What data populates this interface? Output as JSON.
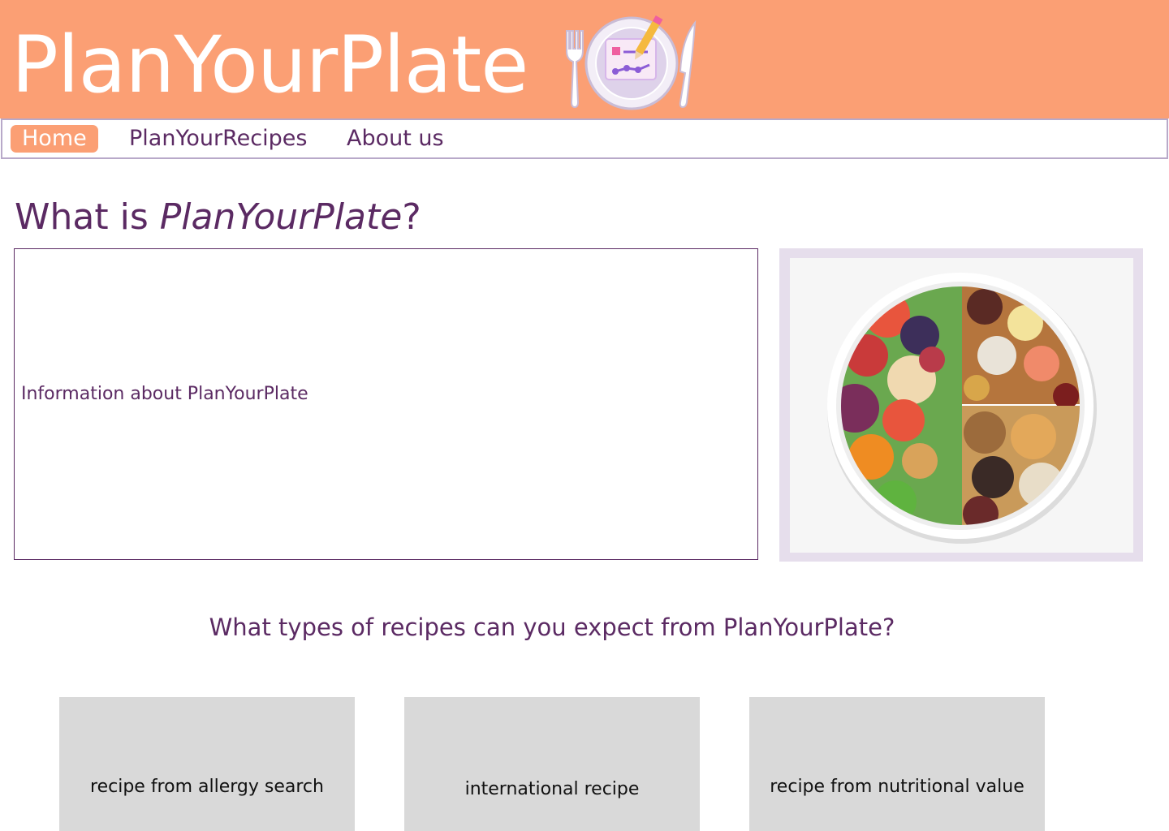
{
  "header": {
    "brand": "PlanYourPlate",
    "colors": {
      "header_bg": "#fb9f74",
      "accent": "#5b2a63",
      "nav_border": "#b8a9c9"
    },
    "logo_icon": "plate-with-fork-knife-planner-icon"
  },
  "nav": {
    "items": [
      {
        "label": "Home",
        "active": true
      },
      {
        "label": "PlanYourRecipes",
        "active": false
      },
      {
        "label": "About us",
        "active": false
      }
    ]
  },
  "main": {
    "title_prefix": "What is ",
    "title_brand": "PlanYourPlate",
    "title_suffix": "?",
    "info_text": "Information about PlanYourPlate",
    "image_icon": "balanced-food-plate-image"
  },
  "recipes": {
    "heading": "What types of recipes can you expect from PlanYourPlate?",
    "cards": [
      {
        "label": "recipe from allergy search"
      },
      {
        "label": "international recipe"
      },
      {
        "label": "recipe from nutritional value"
      }
    ]
  }
}
